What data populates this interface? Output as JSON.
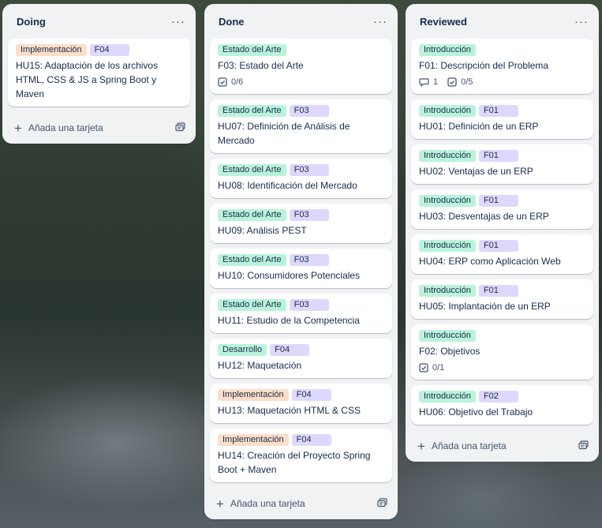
{
  "lists": [
    {
      "title": "Doing",
      "add_label": "Añada una tarjeta",
      "cards": [
        {
          "labels": [
            {
              "text": "Implementación",
              "color": "orange"
            },
            {
              "text": "F04",
              "color": "purple"
            }
          ],
          "title": "HU15: Adaptación de los archivos HTML, CSS & JS a Spring Boot y Maven"
        }
      ]
    },
    {
      "title": "Done",
      "add_label": "Añada una tarjeta",
      "cards": [
        {
          "labels": [
            {
              "text": "Estado del Arte",
              "color": "green"
            }
          ],
          "title": "F03: Estado del Arte",
          "checklist": "0/6"
        },
        {
          "labels": [
            {
              "text": "Estado del Arte",
              "color": "green"
            },
            {
              "text": "F03",
              "color": "purple"
            }
          ],
          "title": "HU07: Definición de Análisis de Mercado"
        },
        {
          "labels": [
            {
              "text": "Estado del Arte",
              "color": "green"
            },
            {
              "text": "F03",
              "color": "purple"
            }
          ],
          "title": "HU08: Identificación del Mercado"
        },
        {
          "labels": [
            {
              "text": "Estado del Arte",
              "color": "green"
            },
            {
              "text": "F03",
              "color": "purple"
            }
          ],
          "title": "HU09: Análisis PEST"
        },
        {
          "labels": [
            {
              "text": "Estado del Arte",
              "color": "green"
            },
            {
              "text": "F03",
              "color": "purple"
            }
          ],
          "title": "HU10: Consumidores Potenciales"
        },
        {
          "labels": [
            {
              "text": "Estado del Arte",
              "color": "green"
            },
            {
              "text": "F03",
              "color": "purple"
            }
          ],
          "title": "HU11: Estudio de la Competencia"
        },
        {
          "labels": [
            {
              "text": "Desarrollo",
              "color": "green"
            },
            {
              "text": "F04",
              "color": "purple"
            }
          ],
          "title": "HU12: Maquetación"
        },
        {
          "labels": [
            {
              "text": "Implementación",
              "color": "orange"
            },
            {
              "text": "F04",
              "color": "purple"
            }
          ],
          "title": "HU13: Maquetación HTML & CSS"
        },
        {
          "labels": [
            {
              "text": "Implementación",
              "color": "orange"
            },
            {
              "text": "F04",
              "color": "purple"
            }
          ],
          "title": "HU14: Creación del Proyecto Spring Boot + Maven"
        }
      ]
    },
    {
      "title": "Reviewed",
      "add_label": "Añada una tarjeta",
      "cards": [
        {
          "labels": [
            {
              "text": "Introducción",
              "color": "green"
            }
          ],
          "title": "F01: Descripción del Problema",
          "comments": "1",
          "checklist": "0/5"
        },
        {
          "labels": [
            {
              "text": "Introducción",
              "color": "green"
            },
            {
              "text": "F01",
              "color": "purple"
            }
          ],
          "title": "HU01: Definición de un ERP"
        },
        {
          "labels": [
            {
              "text": "Introducción",
              "color": "green"
            },
            {
              "text": "F01",
              "color": "purple"
            }
          ],
          "title": "HU02: Ventajas de un ERP"
        },
        {
          "labels": [
            {
              "text": "Introducción",
              "color": "green"
            },
            {
              "text": "F01",
              "color": "purple"
            }
          ],
          "title": "HU03: Desventajas de un ERP"
        },
        {
          "labels": [
            {
              "text": "Introducción",
              "color": "green"
            },
            {
              "text": "F01",
              "color": "purple"
            }
          ],
          "title": "HU04: ERP como Aplicación Web"
        },
        {
          "labels": [
            {
              "text": "Introducción",
              "color": "green"
            },
            {
              "text": "F01",
              "color": "purple"
            }
          ],
          "title": "HU05: Implantación de un ERP"
        },
        {
          "labels": [
            {
              "text": "Introducción",
              "color": "green"
            }
          ],
          "title": "F02: Objetivos",
          "checklist": "0/1"
        },
        {
          "labels": [
            {
              "text": "Introducción",
              "color": "green"
            },
            {
              "text": "F02",
              "color": "purple"
            }
          ],
          "title": "HU06: Objetivo del Trabajo"
        }
      ]
    }
  ],
  "icons": {
    "menu": "more-horizontal-icon",
    "add": "plus-icon",
    "template": "card-template-icon",
    "checklist": "checklist-icon",
    "comment": "comment-icon"
  },
  "colors": {
    "green": "#baf3db",
    "orange": "#fedec8",
    "purple": "#dfd8fd"
  }
}
